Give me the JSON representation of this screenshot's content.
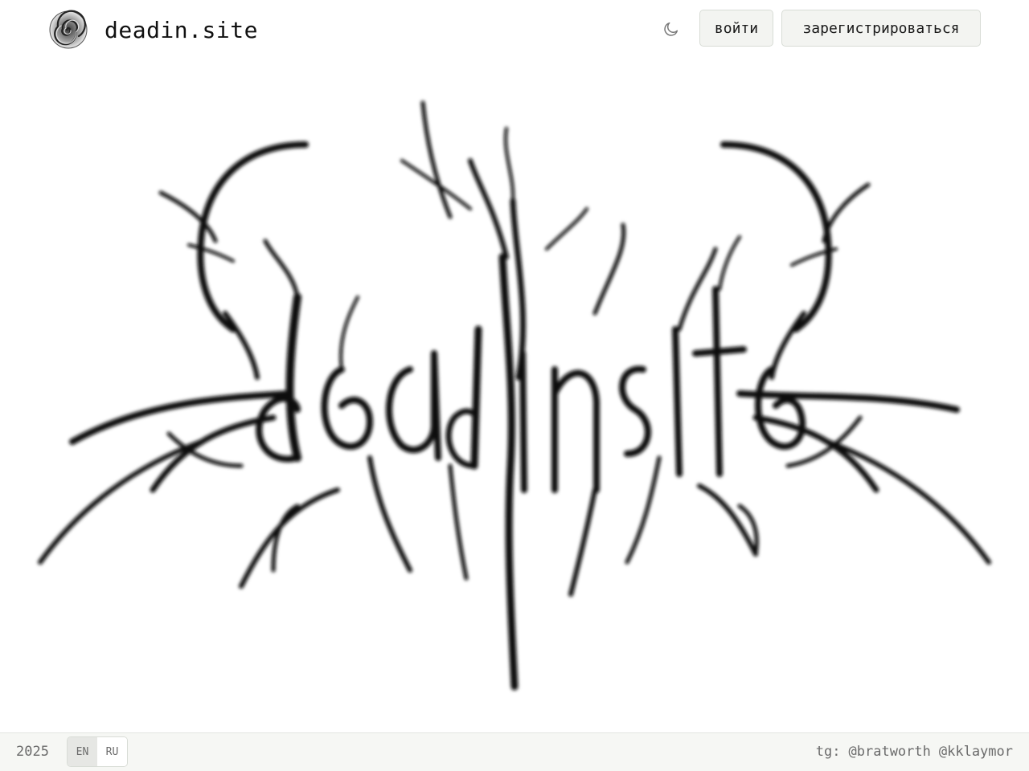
{
  "header": {
    "brand_name": "deadin.site",
    "login_label": "войти",
    "register_label": "зарегистрироваться",
    "theme_icon": "moon-icon"
  },
  "hero": {
    "logo_icon": "blackmetal-logo-artwork"
  },
  "footer": {
    "year": "2025",
    "languages": [
      "EN",
      "RU"
    ],
    "active_language": "EN",
    "contacts_prefix": "tg:",
    "contacts": [
      "@bratworth",
      "@kklaymor"
    ]
  },
  "colors": {
    "button_bg": "#f3f4f1",
    "button_border": "#d8dcd6",
    "footer_bg": "#f6f7f4",
    "muted_text": "#6b6b6b",
    "ink": "#111111"
  }
}
